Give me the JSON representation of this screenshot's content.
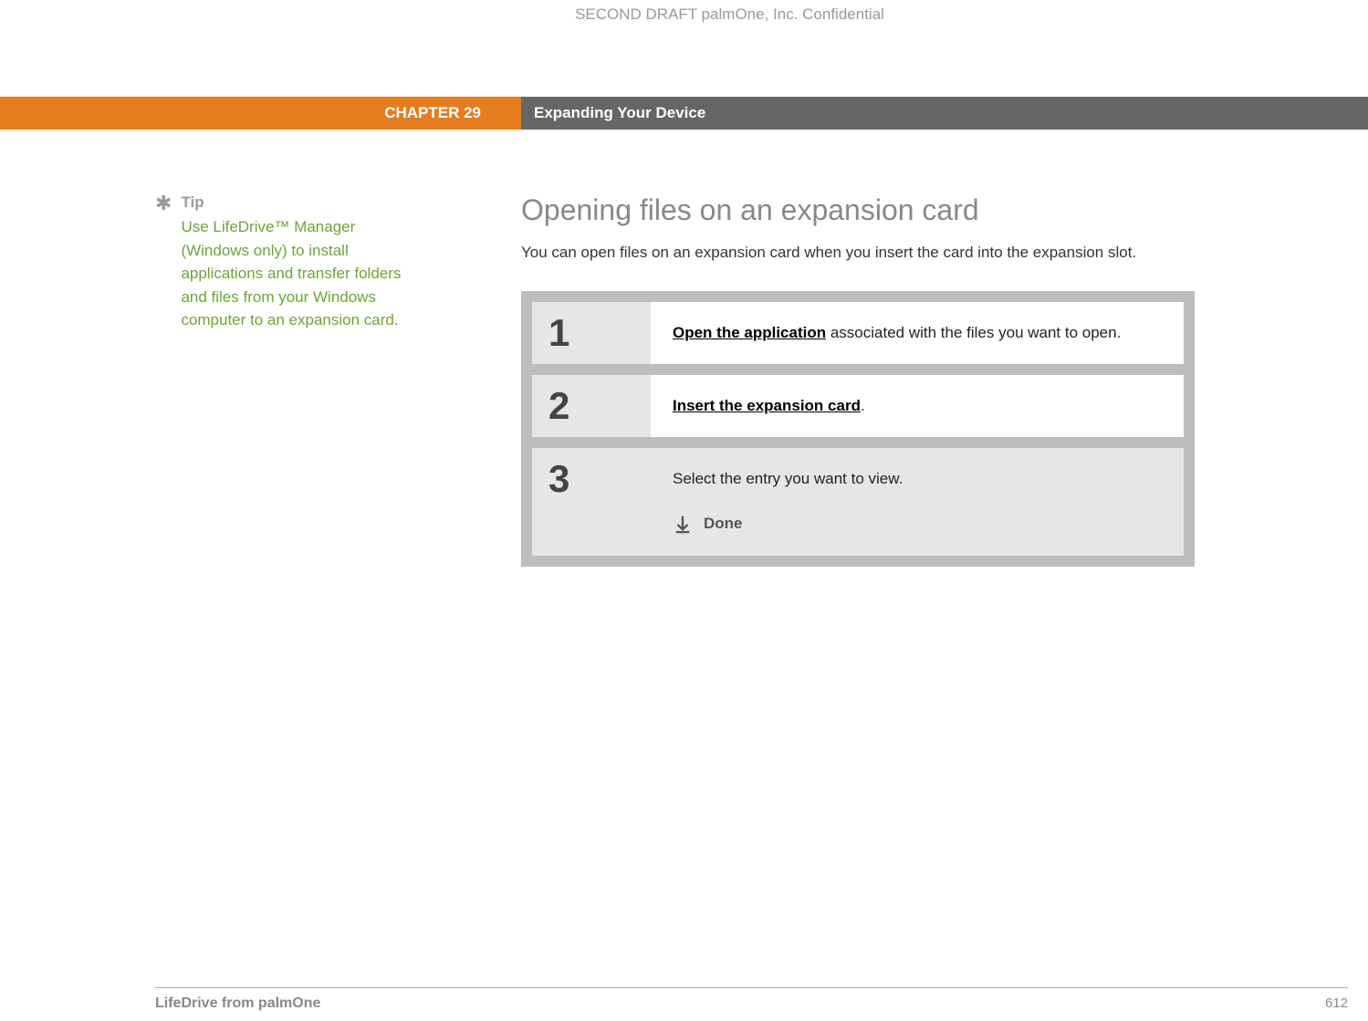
{
  "header": {
    "confidential": "SECOND DRAFT palmOne, Inc.  Confidential"
  },
  "chapter": {
    "label": "CHAPTER 29",
    "title": "Expanding Your Device"
  },
  "sidebar": {
    "tip_label": "Tip",
    "tip_text": "Use LifeDrive™ Manager (Windows only) to install applications and transfer folders and files from your Windows computer to an expansion card."
  },
  "main": {
    "title": "Opening files on an expansion card",
    "intro": "You can open files on an expansion card when you insert the card into the expansion slot.",
    "steps": [
      {
        "number": "1",
        "link": "Open the application",
        "rest": " associated with the files you want to open."
      },
      {
        "number": "2",
        "link": "Insert the expansion card",
        "rest": "."
      },
      {
        "number": "3",
        "text": "Select the entry you want to view.",
        "done": "Done"
      }
    ]
  },
  "footer": {
    "left": "LifeDrive from palmOne",
    "right": "612"
  }
}
